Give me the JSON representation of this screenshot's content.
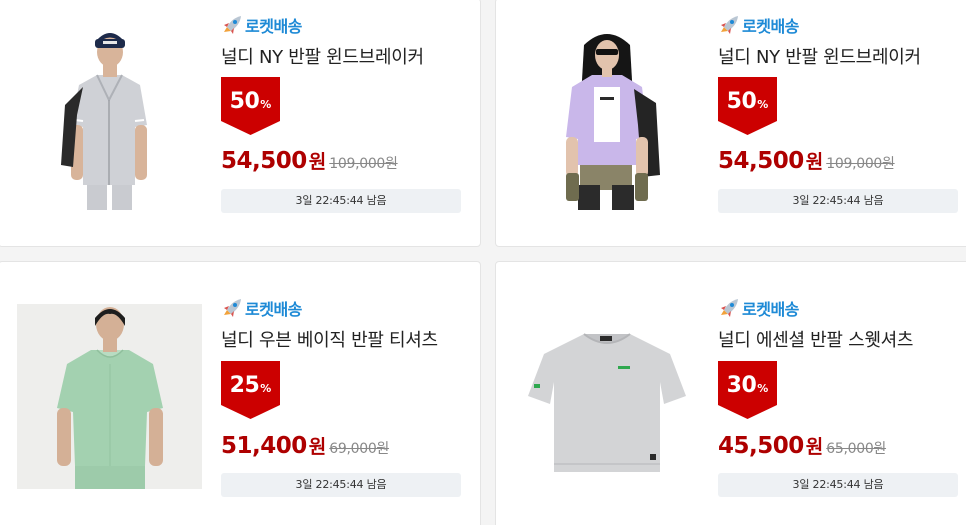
{
  "products": [
    {
      "delivery_label": "로켓배송",
      "name": "널디 NY 반팔 윈드브레이커",
      "discount_number": "50",
      "discount_percent_sign": "%",
      "sale_price": "54,500",
      "currency_label": "원",
      "original_price": "109,000원",
      "timer_text": "3일 22:45:44 남음",
      "image_icon": "model-gray-windbreaker"
    },
    {
      "delivery_label": "로켓배송",
      "name": "널디 NY 반팔 윈드브레이커",
      "discount_number": "50",
      "discount_percent_sign": "%",
      "sale_price": "54,500",
      "currency_label": "원",
      "original_price": "109,000원",
      "timer_text": "3일 22:45:44 남음",
      "image_icon": "model-lavender-windbreaker"
    },
    {
      "delivery_label": "로켓배송",
      "name": "널디 우븐 베이직 반팔 티셔츠",
      "discount_number": "25",
      "discount_percent_sign": "%",
      "sale_price": "51,400",
      "currency_label": "원",
      "original_price": "69,000원",
      "timer_text": "3일 22:45:44 남음",
      "image_icon": "model-mint-tshirt"
    },
    {
      "delivery_label": "로켓배송",
      "name": "널디 에센셜 반팔 스웻셔츠",
      "discount_number": "30",
      "discount_percent_sign": "%",
      "sale_price": "45,500",
      "currency_label": "원",
      "original_price": "65,000원",
      "timer_text": "3일 22:45:44 남음",
      "image_icon": "gray-sweatshirt-product"
    }
  ],
  "colors": {
    "rocket_blue": "#1e8ad6",
    "badge_red": "#cc0000",
    "price_red": "#ae0000",
    "timer_bg": "#eef1f4"
  }
}
